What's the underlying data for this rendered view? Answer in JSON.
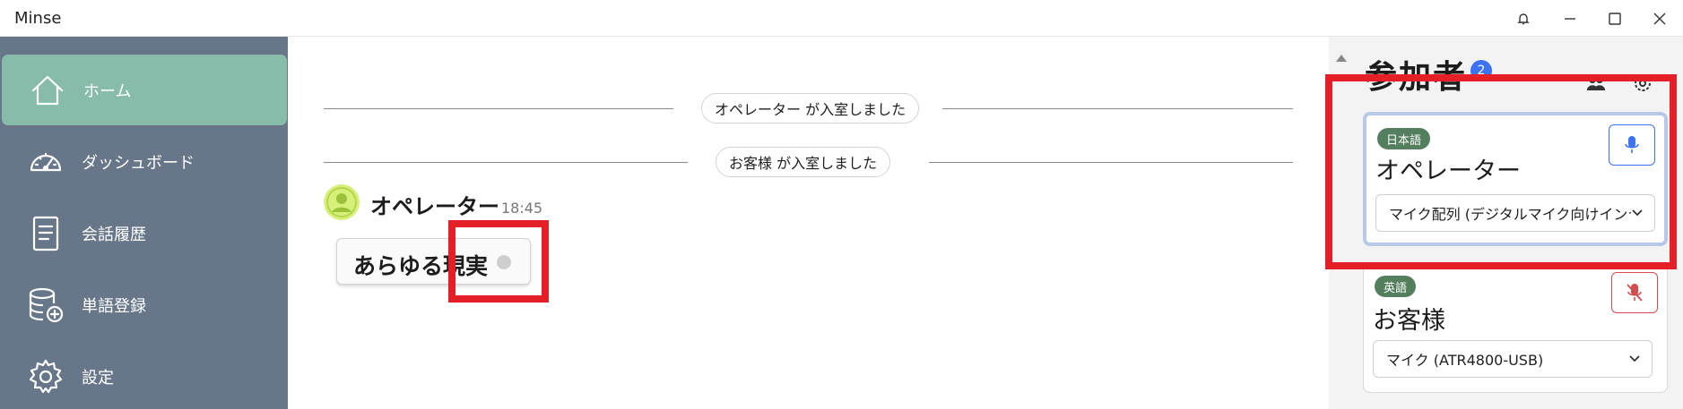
{
  "window": {
    "title": "Minse",
    "controls": [
      "bell-icon",
      "minimize-icon",
      "maximize-icon",
      "close-icon"
    ]
  },
  "sidebar": {
    "items": [
      {
        "label": "ホーム",
        "icon": "home-icon",
        "active": true
      },
      {
        "label": "ダッシュボード",
        "icon": "dashboard-gauge-icon",
        "active": false
      },
      {
        "label": "会話履歴",
        "icon": "document-icon",
        "active": false
      },
      {
        "label": "単語登録",
        "icon": "database-add-icon",
        "active": false
      },
      {
        "label": "設定",
        "icon": "gear-icon",
        "active": false
      }
    ]
  },
  "chat": {
    "system_messages": [
      {
        "text": "オペレーター が入室しました"
      },
      {
        "text": "お客様 が入室しました"
      }
    ],
    "message": {
      "sender": "オペレーター",
      "time": "18:45",
      "text": "あらゆる現実",
      "avatar_icon": "user-avatar-icon"
    }
  },
  "participants": {
    "title": "参加者",
    "count": "2",
    "cards": [
      {
        "language": "日本語",
        "name": "オペレーター",
        "device": "マイク配列 (デジタルマイク向けインテル® スマート・サウンド・テクノロジー)",
        "mic_state": "on"
      },
      {
        "language": "英語",
        "name": "お客様",
        "device": "マイク (ATR4800-USB)",
        "mic_state": "muted"
      }
    ]
  },
  "colors": {
    "sidebar_bg": "#677789",
    "sidebar_active": "#86bca9",
    "highlight_red": "#e41f26",
    "badge_blue": "#3d73f0",
    "lang_badge_green": "#537f5e"
  }
}
